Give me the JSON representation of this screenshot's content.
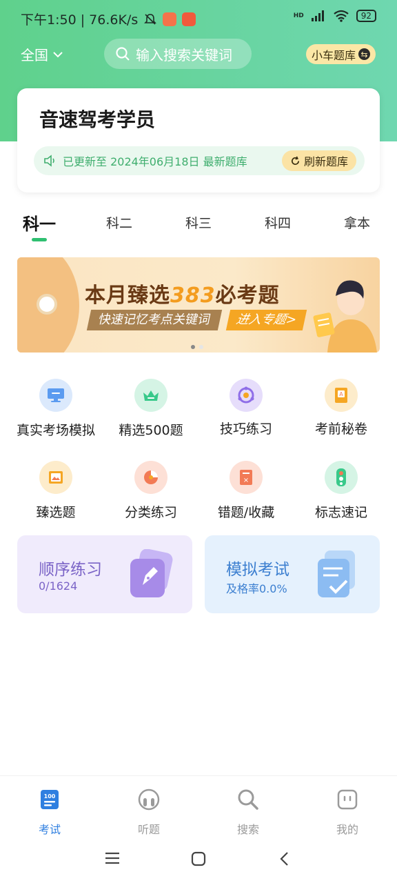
{
  "status_bar": {
    "time_speed": "下午1:50 | 76.6K/s",
    "battery": "92",
    "signal_label": "HD"
  },
  "header": {
    "region": "全国",
    "search_placeholder": "输入搜索关键词",
    "qbank_label": "小车题库"
  },
  "student_card": {
    "title": "音速驾考学员",
    "update_text": "已更新至 2024年06月18日 最新题库",
    "refresh_label": "刷新题库"
  },
  "subject_tabs": [
    {
      "label": "科一",
      "active": true
    },
    {
      "label": "科二",
      "active": false
    },
    {
      "label": "科三",
      "active": false
    },
    {
      "label": "科四",
      "active": false
    },
    {
      "label": "拿本",
      "active": false
    }
  ],
  "banner": {
    "title_prefix": "本月臻选",
    "title_number": "383",
    "title_suffix": "必考题",
    "subtitle": "快速记忆考点关键词",
    "cta": "进入专题>"
  },
  "grid": [
    {
      "label": "真实考场模拟",
      "icon": "monitor-icon",
      "color": "#5b9bf0"
    },
    {
      "label": "精选500题",
      "icon": "crown-icon",
      "color": "#38c98a"
    },
    {
      "label": "技巧练习",
      "icon": "skill-icon",
      "color": "#8f6ee8"
    },
    {
      "label": "考前秘卷",
      "icon": "book-icon",
      "color": "#f5a623"
    },
    {
      "label": "臻选题",
      "icon": "picture-icon",
      "color": "#f5a623"
    },
    {
      "label": "分类练习",
      "icon": "pie-chart-icon",
      "color": "#f27a55"
    },
    {
      "label": "错题/收藏",
      "icon": "notebook-icon",
      "color": "#f27a55"
    },
    {
      "label": "标志速记",
      "icon": "traffic-light-icon",
      "color": "#38c98a"
    }
  ],
  "practice": {
    "sequential": {
      "title": "顺序练习",
      "progress": "0/1624"
    },
    "mock_exam": {
      "title": "模拟考试",
      "pass_rate": "及格率0.0%"
    }
  },
  "bottom_nav": [
    {
      "label": "考试",
      "icon": "exam-icon",
      "active": true
    },
    {
      "label": "听题",
      "icon": "listen-icon",
      "active": false
    },
    {
      "label": "搜索",
      "icon": "search-icon",
      "active": false
    },
    {
      "label": "我的",
      "icon": "profile-icon",
      "active": false
    }
  ],
  "colors": {
    "brand_green": "#5fd18c",
    "accent_blue": "#2f7fe0",
    "accent_yellow": "#fbe3a5"
  }
}
